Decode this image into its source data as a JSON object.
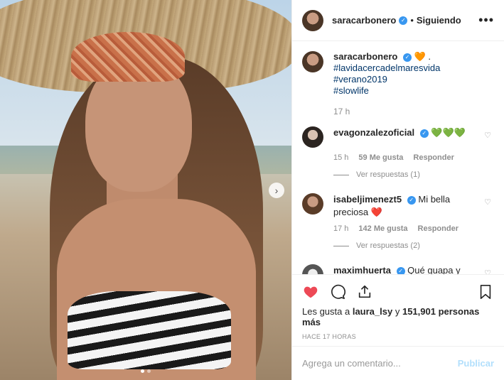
{
  "post": {
    "username": "saracarbonero",
    "follow_status": "Siguiendo",
    "more_icon": "more-horizontal-icon",
    "carousel": {
      "slides": 2,
      "active": 0
    }
  },
  "caption": {
    "username": "saracarbonero",
    "emoji": "🧡 .",
    "hashtags": [
      "#lavidacercadelmaresvida",
      "#verano2019",
      "#slowlife"
    ],
    "time": "17 h"
  },
  "comments": [
    {
      "username": "evagonzalezoficial",
      "text": "💚💚💚",
      "time": "15 h",
      "likes": "59 Me gusta",
      "reply": "Responder",
      "replies": "Ver respuestas (1)"
    },
    {
      "username": "isabeljimenezt5",
      "text": "Mi bella preciosa ❤️",
      "time": "17 h",
      "likes": "142 Me gusta",
      "reply": "Responder",
      "replies": "Ver respuestas (2)"
    },
    {
      "username": "maximhuerta",
      "text": "Qué guapa y luminosa eres. ❤️"
    }
  ],
  "likes_line": {
    "prefix": "Les gusta a",
    "user": "laura_lsy",
    "middle": "y",
    "count": "151,901 personas más"
  },
  "posted_ago": "HACE 17 HORAS",
  "comment_box": {
    "placeholder": "Agrega un comentario...",
    "publish": "Publicar"
  },
  "colors": {
    "accent": "#3897f0",
    "like_red": "#ed4956",
    "link": "#003569"
  }
}
